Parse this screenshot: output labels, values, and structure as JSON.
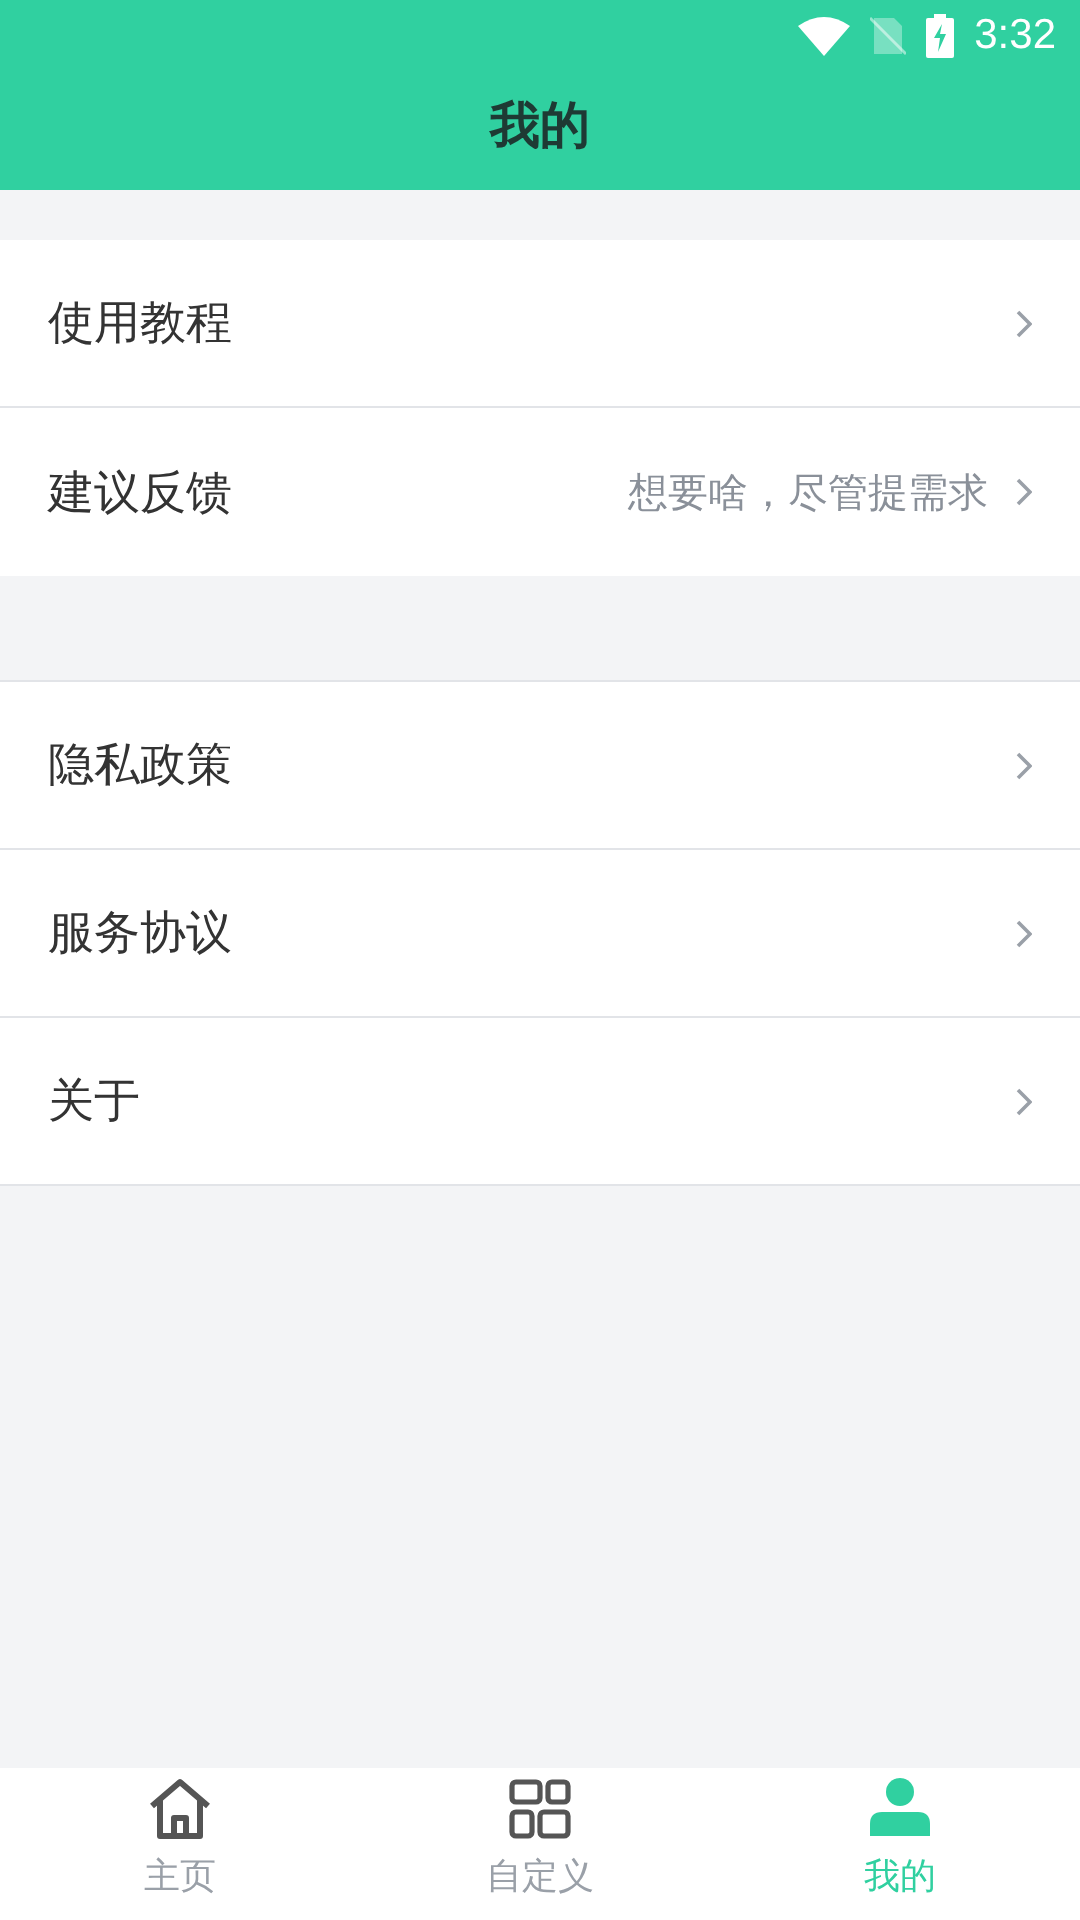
{
  "status_bar": {
    "time": "3:32"
  },
  "header": {
    "title": "我的"
  },
  "groups": [
    {
      "items": [
        {
          "label": "使用教程"
        },
        {
          "label": "建议反馈",
          "hint": "想要啥，尽管提需求"
        }
      ]
    },
    {
      "items": [
        {
          "label": "隐私政策"
        },
        {
          "label": "服务协议"
        },
        {
          "label": "关于"
        }
      ]
    }
  ],
  "tabs": [
    {
      "label": "主页",
      "kind": "home",
      "selected": false
    },
    {
      "label": "自定义",
      "kind": "grid",
      "selected": false
    },
    {
      "label": "我的",
      "kind": "person",
      "selected": true
    }
  ]
}
